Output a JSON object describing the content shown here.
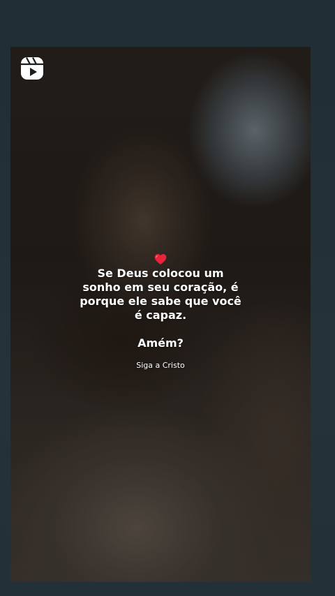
{
  "app": {
    "icon": "reels-icon",
    "background_color": "#1f2d35"
  },
  "caption": {
    "heart_icon": "red-heart-emoji",
    "heart_color": "#e8233b",
    "lines": [
      "Se Deus colocou um",
      "sonho em seu coração, é",
      "porque ele sabe que você",
      "é capaz."
    ],
    "closing": "Amém?",
    "credit": "Siga a Cristo"
  }
}
